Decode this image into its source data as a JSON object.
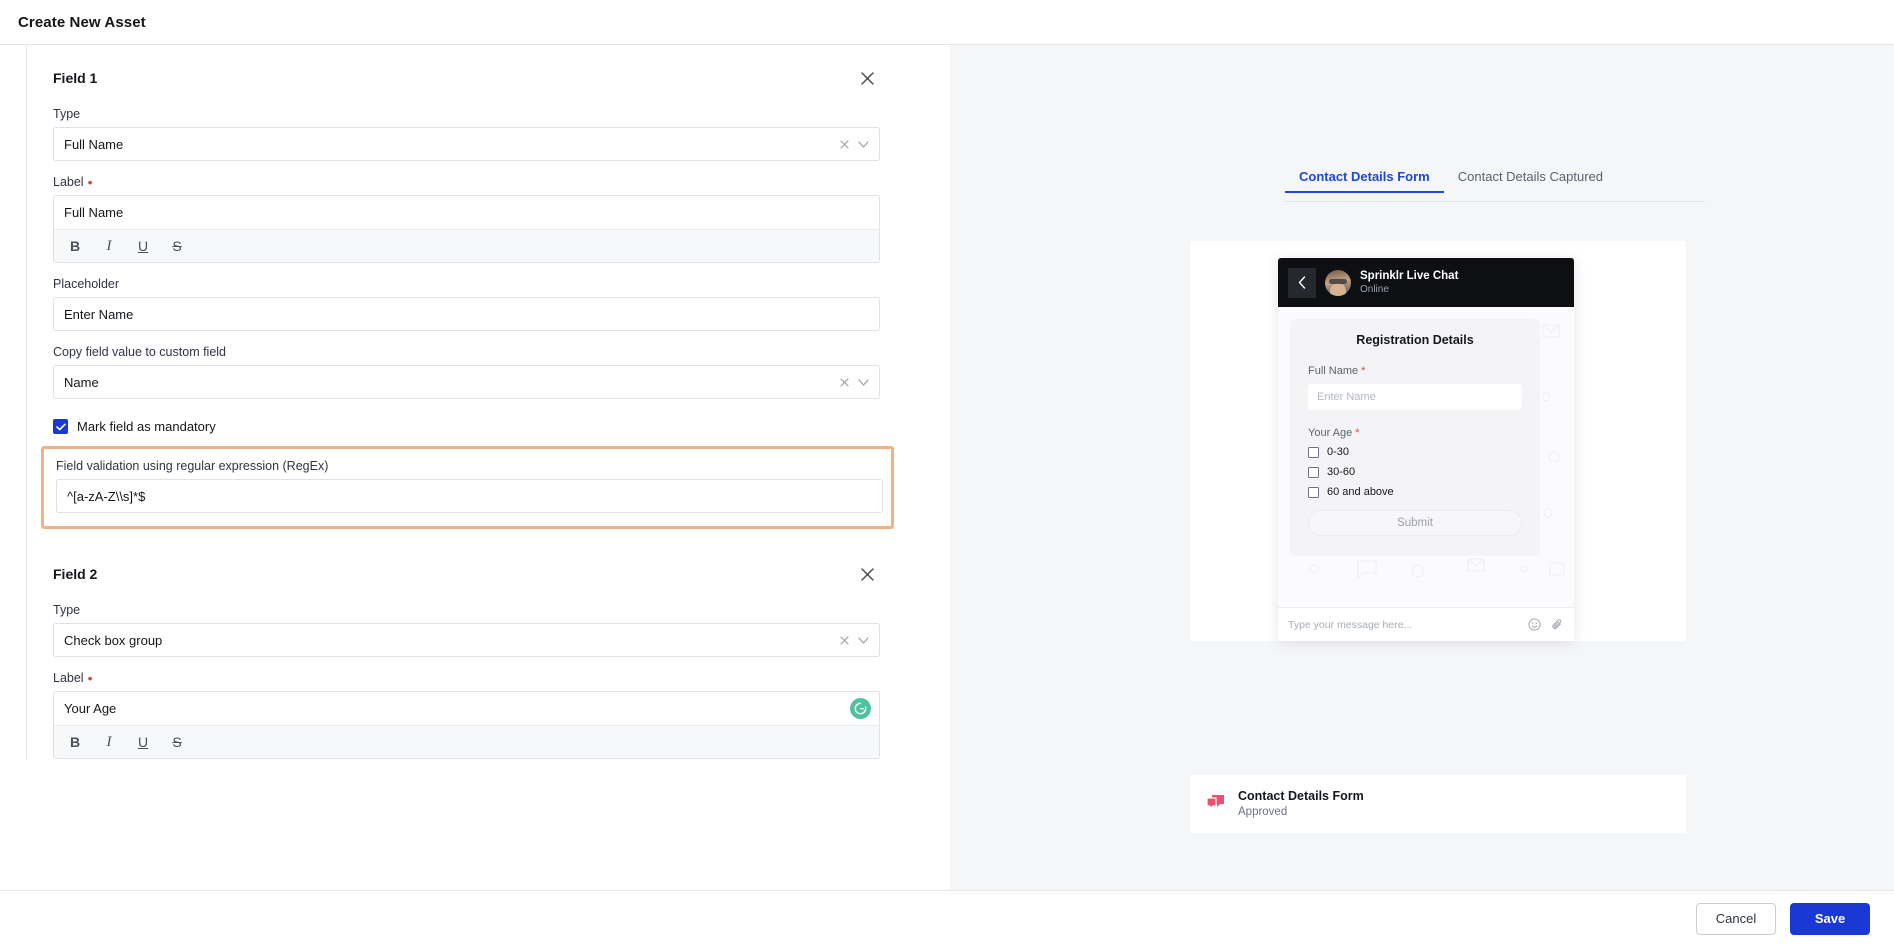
{
  "header": {
    "title": "Create New Asset"
  },
  "fields": [
    {
      "title": "Field 1",
      "type_label": "Type",
      "type_value": "Full Name",
      "label_label": "Label",
      "label_value": "Full Name",
      "placeholder_label": "Placeholder",
      "placeholder_value": "Enter Name",
      "copy_label": "Copy field value to custom field",
      "copy_value": "Name",
      "mandatory_label": "Mark field as mandatory",
      "mandatory_checked": true,
      "regex_label": "Field validation using regular expression (RegEx)",
      "regex_value": "^[a-zA-Z\\\\s]*$",
      "highlight_color": "#f0b183"
    },
    {
      "title": "Field 2",
      "type_label": "Type",
      "type_value": "Check box group",
      "label_label": "Label",
      "label_value": "Your Age"
    }
  ],
  "rte_toolbar": [
    {
      "name": "bold",
      "glyph": "B"
    },
    {
      "name": "italic",
      "glyph": "I"
    },
    {
      "name": "underline",
      "glyph": "U"
    },
    {
      "name": "strikethrough",
      "glyph": "S"
    }
  ],
  "preview": {
    "tabs": [
      {
        "label": "Contact Details Form",
        "active": true
      },
      {
        "label": "Contact Details Captured",
        "active": false
      }
    ],
    "chat": {
      "name": "Sprinklr Live Chat",
      "status": "Online",
      "form_title": "Registration Details",
      "full_name_label": "Full Name",
      "full_name_required": "*",
      "full_name_placeholder": "Enter Name",
      "age_label": "Your Age",
      "age_required": "*",
      "age_options": [
        "0-30",
        "30-60",
        "60 and above"
      ],
      "submit_label": "Submit",
      "message_placeholder": "Type your message here..."
    },
    "asset": {
      "title": "Contact Details Form",
      "status": "Approved",
      "icon_color": "#ef4e72"
    }
  },
  "footer": {
    "cancel_label": "Cancel",
    "save_label": "Save",
    "save_color": "#1a39d4"
  }
}
